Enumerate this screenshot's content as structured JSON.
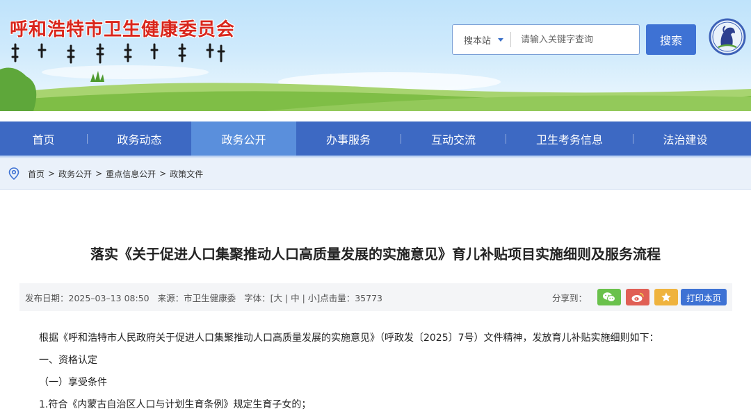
{
  "header": {
    "site_title": "呼和浩特市卫生健康委员会",
    "search": {
      "scope_label": "搜本站",
      "placeholder": "请输入关键字查询",
      "button_label": "搜索"
    },
    "logo_icon": "horse-emblem-logo"
  },
  "nav": {
    "items": [
      {
        "label": "首页"
      },
      {
        "label": "政务动态"
      },
      {
        "label": "政务公开",
        "active": true
      },
      {
        "label": "办事服务"
      },
      {
        "label": "互动交流"
      },
      {
        "label": "卫生考务信息"
      },
      {
        "label": "法治建设"
      }
    ]
  },
  "breadcrumb": {
    "icon": "location-pin-icon",
    "items": [
      "首页",
      "政务公开",
      "重点信息公开",
      "政策文件"
    ],
    "separator": ">"
  },
  "article": {
    "title": "落实《关于促进人口集聚推动人口高质量发展的实施意见》育儿补贴项目实施细则及服务流程",
    "meta": {
      "publish_date": "发布日期：2025–03–13 08:50",
      "source": "来源：市卫生健康委",
      "font_size": "字体：[大 | 中 | 小]",
      "clicks": "点击量：35773",
      "share_label": "分享到：",
      "print_label": "打印本页"
    },
    "paragraphs": [
      "根据《呼和浩特市人民政府关于促进人口集聚推动人口高质量发展的实施意见》（呼政发〔2025〕7号）文件精神，发放育儿补贴实施细则如下：",
      "一、资格认定",
      "（一）享受条件",
      "1.符合《内蒙古自治区人口与计划生育条例》规定生育子女的；"
    ]
  },
  "colors": {
    "nav_bg": "#3d69c3",
    "nav_active": "#5a8fdc",
    "title_red": "#d9261c",
    "button_blue": "#3e72d4"
  }
}
